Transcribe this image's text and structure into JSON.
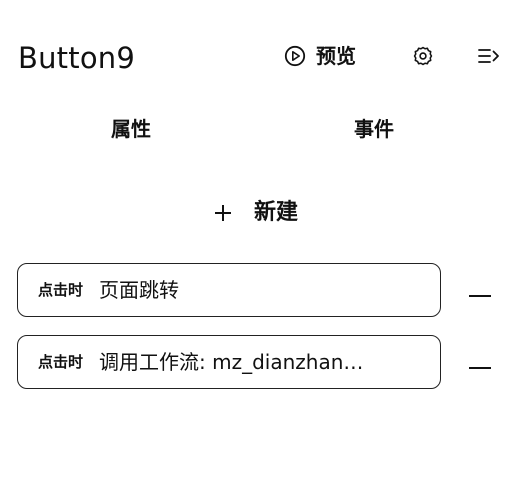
{
  "header": {
    "title": "Button9",
    "preview_label": "预览",
    "icons": [
      "play-circle-icon",
      "gear-icon",
      "collapse-panel-icon"
    ]
  },
  "tabs": [
    {
      "label": "属性"
    },
    {
      "label": "事件"
    }
  ],
  "new_button": {
    "label": "新建",
    "icon": "plus-icon"
  },
  "events": [
    {
      "trigger": "点击时",
      "action": "页面跳转"
    },
    {
      "trigger": "点击时",
      "action": "调用工作流: mz_dianzhan…"
    }
  ],
  "colors": {
    "text": "#111111",
    "border": "#222222",
    "background": "#ffffff"
  }
}
